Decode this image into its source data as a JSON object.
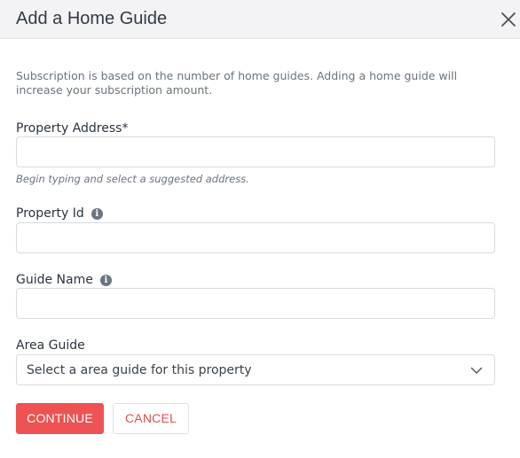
{
  "header": {
    "title": "Add a Home Guide"
  },
  "description": "Subscription is based on the number of home guides. Adding a home guide will increase your subscription amount.",
  "fields": {
    "property_address": {
      "label": "Property Address*",
      "value": "",
      "hint": "Begin typing and select a suggested address."
    },
    "property_id": {
      "label": "Property Id",
      "value": "",
      "info_icon": "info-icon"
    },
    "guide_name": {
      "label": "Guide Name",
      "value": "",
      "info_icon": "info-icon"
    },
    "area_guide": {
      "label": "Area Guide",
      "selected": "Select a area guide for this property",
      "icon": "chevron-down-icon"
    }
  },
  "buttons": {
    "continue": "CONTINUE",
    "cancel": "CANCEL"
  },
  "colors": {
    "accent": "#ee5253",
    "header_bg": "#f3f3f5",
    "border": "#d8dbe0"
  }
}
